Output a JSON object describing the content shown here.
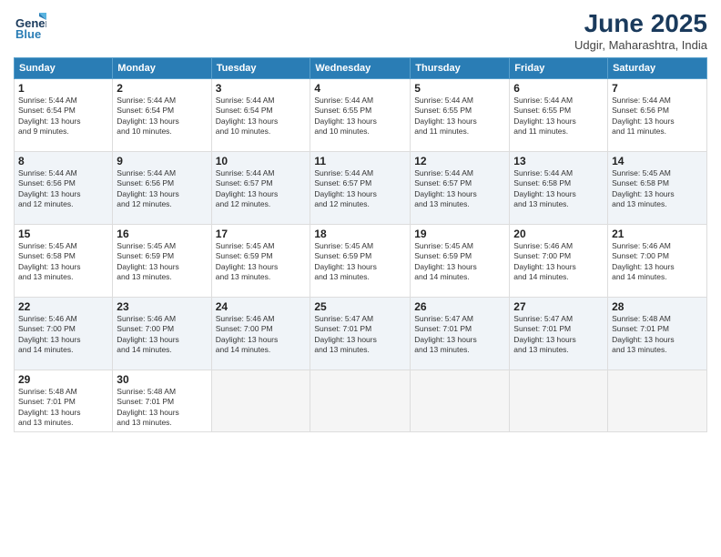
{
  "header": {
    "logo_line1": "General",
    "logo_line2": "Blue",
    "title": "June 2025",
    "subtitle": "Udgir, Maharashtra, India"
  },
  "days_of_week": [
    "Sunday",
    "Monday",
    "Tuesday",
    "Wednesday",
    "Thursday",
    "Friday",
    "Saturday"
  ],
  "weeks": [
    [
      {
        "day": 1,
        "info": "Sunrise: 5:44 AM\nSunset: 6:54 PM\nDaylight: 13 hours\nand 9 minutes."
      },
      {
        "day": 2,
        "info": "Sunrise: 5:44 AM\nSunset: 6:54 PM\nDaylight: 13 hours\nand 10 minutes."
      },
      {
        "day": 3,
        "info": "Sunrise: 5:44 AM\nSunset: 6:54 PM\nDaylight: 13 hours\nand 10 minutes."
      },
      {
        "day": 4,
        "info": "Sunrise: 5:44 AM\nSunset: 6:55 PM\nDaylight: 13 hours\nand 10 minutes."
      },
      {
        "day": 5,
        "info": "Sunrise: 5:44 AM\nSunset: 6:55 PM\nDaylight: 13 hours\nand 11 minutes."
      },
      {
        "day": 6,
        "info": "Sunrise: 5:44 AM\nSunset: 6:55 PM\nDaylight: 13 hours\nand 11 minutes."
      },
      {
        "day": 7,
        "info": "Sunrise: 5:44 AM\nSunset: 6:56 PM\nDaylight: 13 hours\nand 11 minutes."
      }
    ],
    [
      {
        "day": 8,
        "info": "Sunrise: 5:44 AM\nSunset: 6:56 PM\nDaylight: 13 hours\nand 12 minutes."
      },
      {
        "day": 9,
        "info": "Sunrise: 5:44 AM\nSunset: 6:56 PM\nDaylight: 13 hours\nand 12 minutes."
      },
      {
        "day": 10,
        "info": "Sunrise: 5:44 AM\nSunset: 6:57 PM\nDaylight: 13 hours\nand 12 minutes."
      },
      {
        "day": 11,
        "info": "Sunrise: 5:44 AM\nSunset: 6:57 PM\nDaylight: 13 hours\nand 12 minutes."
      },
      {
        "day": 12,
        "info": "Sunrise: 5:44 AM\nSunset: 6:57 PM\nDaylight: 13 hours\nand 13 minutes."
      },
      {
        "day": 13,
        "info": "Sunrise: 5:44 AM\nSunset: 6:58 PM\nDaylight: 13 hours\nand 13 minutes."
      },
      {
        "day": 14,
        "info": "Sunrise: 5:45 AM\nSunset: 6:58 PM\nDaylight: 13 hours\nand 13 minutes."
      }
    ],
    [
      {
        "day": 15,
        "info": "Sunrise: 5:45 AM\nSunset: 6:58 PM\nDaylight: 13 hours\nand 13 minutes."
      },
      {
        "day": 16,
        "info": "Sunrise: 5:45 AM\nSunset: 6:59 PM\nDaylight: 13 hours\nand 13 minutes."
      },
      {
        "day": 17,
        "info": "Sunrise: 5:45 AM\nSunset: 6:59 PM\nDaylight: 13 hours\nand 13 minutes."
      },
      {
        "day": 18,
        "info": "Sunrise: 5:45 AM\nSunset: 6:59 PM\nDaylight: 13 hours\nand 13 minutes."
      },
      {
        "day": 19,
        "info": "Sunrise: 5:45 AM\nSunset: 6:59 PM\nDaylight: 13 hours\nand 14 minutes."
      },
      {
        "day": 20,
        "info": "Sunrise: 5:46 AM\nSunset: 7:00 PM\nDaylight: 13 hours\nand 14 minutes."
      },
      {
        "day": 21,
        "info": "Sunrise: 5:46 AM\nSunset: 7:00 PM\nDaylight: 13 hours\nand 14 minutes."
      }
    ],
    [
      {
        "day": 22,
        "info": "Sunrise: 5:46 AM\nSunset: 7:00 PM\nDaylight: 13 hours\nand 14 minutes."
      },
      {
        "day": 23,
        "info": "Sunrise: 5:46 AM\nSunset: 7:00 PM\nDaylight: 13 hours\nand 14 minutes."
      },
      {
        "day": 24,
        "info": "Sunrise: 5:46 AM\nSunset: 7:00 PM\nDaylight: 13 hours\nand 14 minutes."
      },
      {
        "day": 25,
        "info": "Sunrise: 5:47 AM\nSunset: 7:01 PM\nDaylight: 13 hours\nand 13 minutes."
      },
      {
        "day": 26,
        "info": "Sunrise: 5:47 AM\nSunset: 7:01 PM\nDaylight: 13 hours\nand 13 minutes."
      },
      {
        "day": 27,
        "info": "Sunrise: 5:47 AM\nSunset: 7:01 PM\nDaylight: 13 hours\nand 13 minutes."
      },
      {
        "day": 28,
        "info": "Sunrise: 5:48 AM\nSunset: 7:01 PM\nDaylight: 13 hours\nand 13 minutes."
      }
    ],
    [
      {
        "day": 29,
        "info": "Sunrise: 5:48 AM\nSunset: 7:01 PM\nDaylight: 13 hours\nand 13 minutes."
      },
      {
        "day": 30,
        "info": "Sunrise: 5:48 AM\nSunset: 7:01 PM\nDaylight: 13 hours\nand 13 minutes."
      },
      null,
      null,
      null,
      null,
      null
    ]
  ]
}
